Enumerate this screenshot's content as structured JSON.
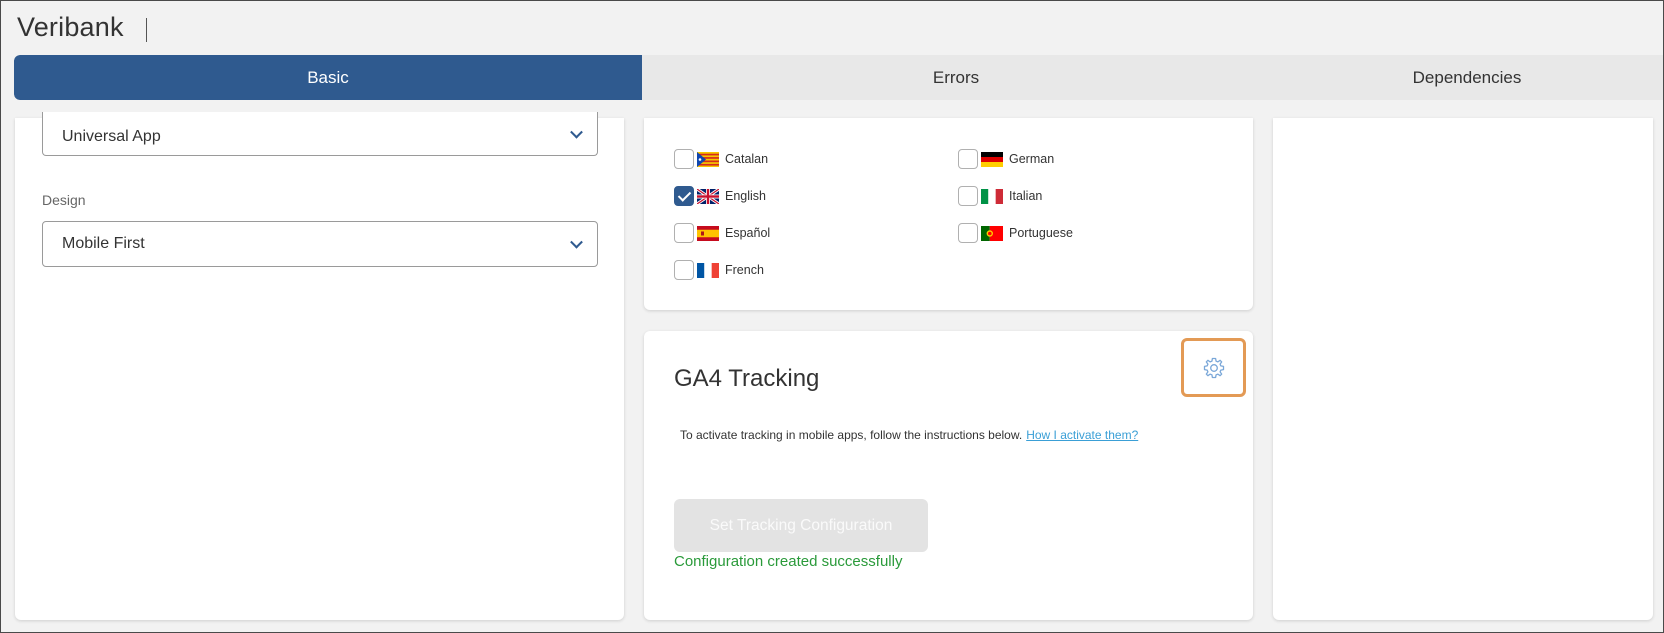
{
  "app": {
    "title": "Veribank"
  },
  "tabs": [
    {
      "label": "Basic",
      "active": true
    },
    {
      "label": "Errors",
      "active": false
    },
    {
      "label": "Dependencies",
      "active": false
    }
  ],
  "left": {
    "app_type_value": "Universal App",
    "design_label": "Design",
    "design_value": "Mobile First"
  },
  "languages": [
    {
      "name": "Catalan",
      "checked": false,
      "flag": "catalan-flag-icon"
    },
    {
      "name": "English",
      "checked": true,
      "flag": "uk-flag-icon"
    },
    {
      "name": "Español",
      "checked": false,
      "flag": "spain-flag-icon"
    },
    {
      "name": "French",
      "checked": false,
      "flag": "france-flag-icon"
    },
    {
      "name": "German",
      "checked": false,
      "flag": "germany-flag-icon"
    },
    {
      "name": "Italian",
      "checked": false,
      "flag": "italy-flag-icon"
    },
    {
      "name": "Portuguese",
      "checked": false,
      "flag": "portugal-flag-icon"
    }
  ],
  "ga4": {
    "title": "GA4 Tracking",
    "description": "To activate tracking in mobile apps, follow the instructions below.",
    "link": "How I activate them?",
    "button": "Set Tracking Configuration",
    "button_enabled": false,
    "status": "Configuration created successfully",
    "settings_icon": "gear-icon"
  },
  "colors": {
    "accent": "#2f5a8f",
    "success": "#2a9a3a",
    "link": "#3a9fd6",
    "highlight": "#e39a55"
  }
}
